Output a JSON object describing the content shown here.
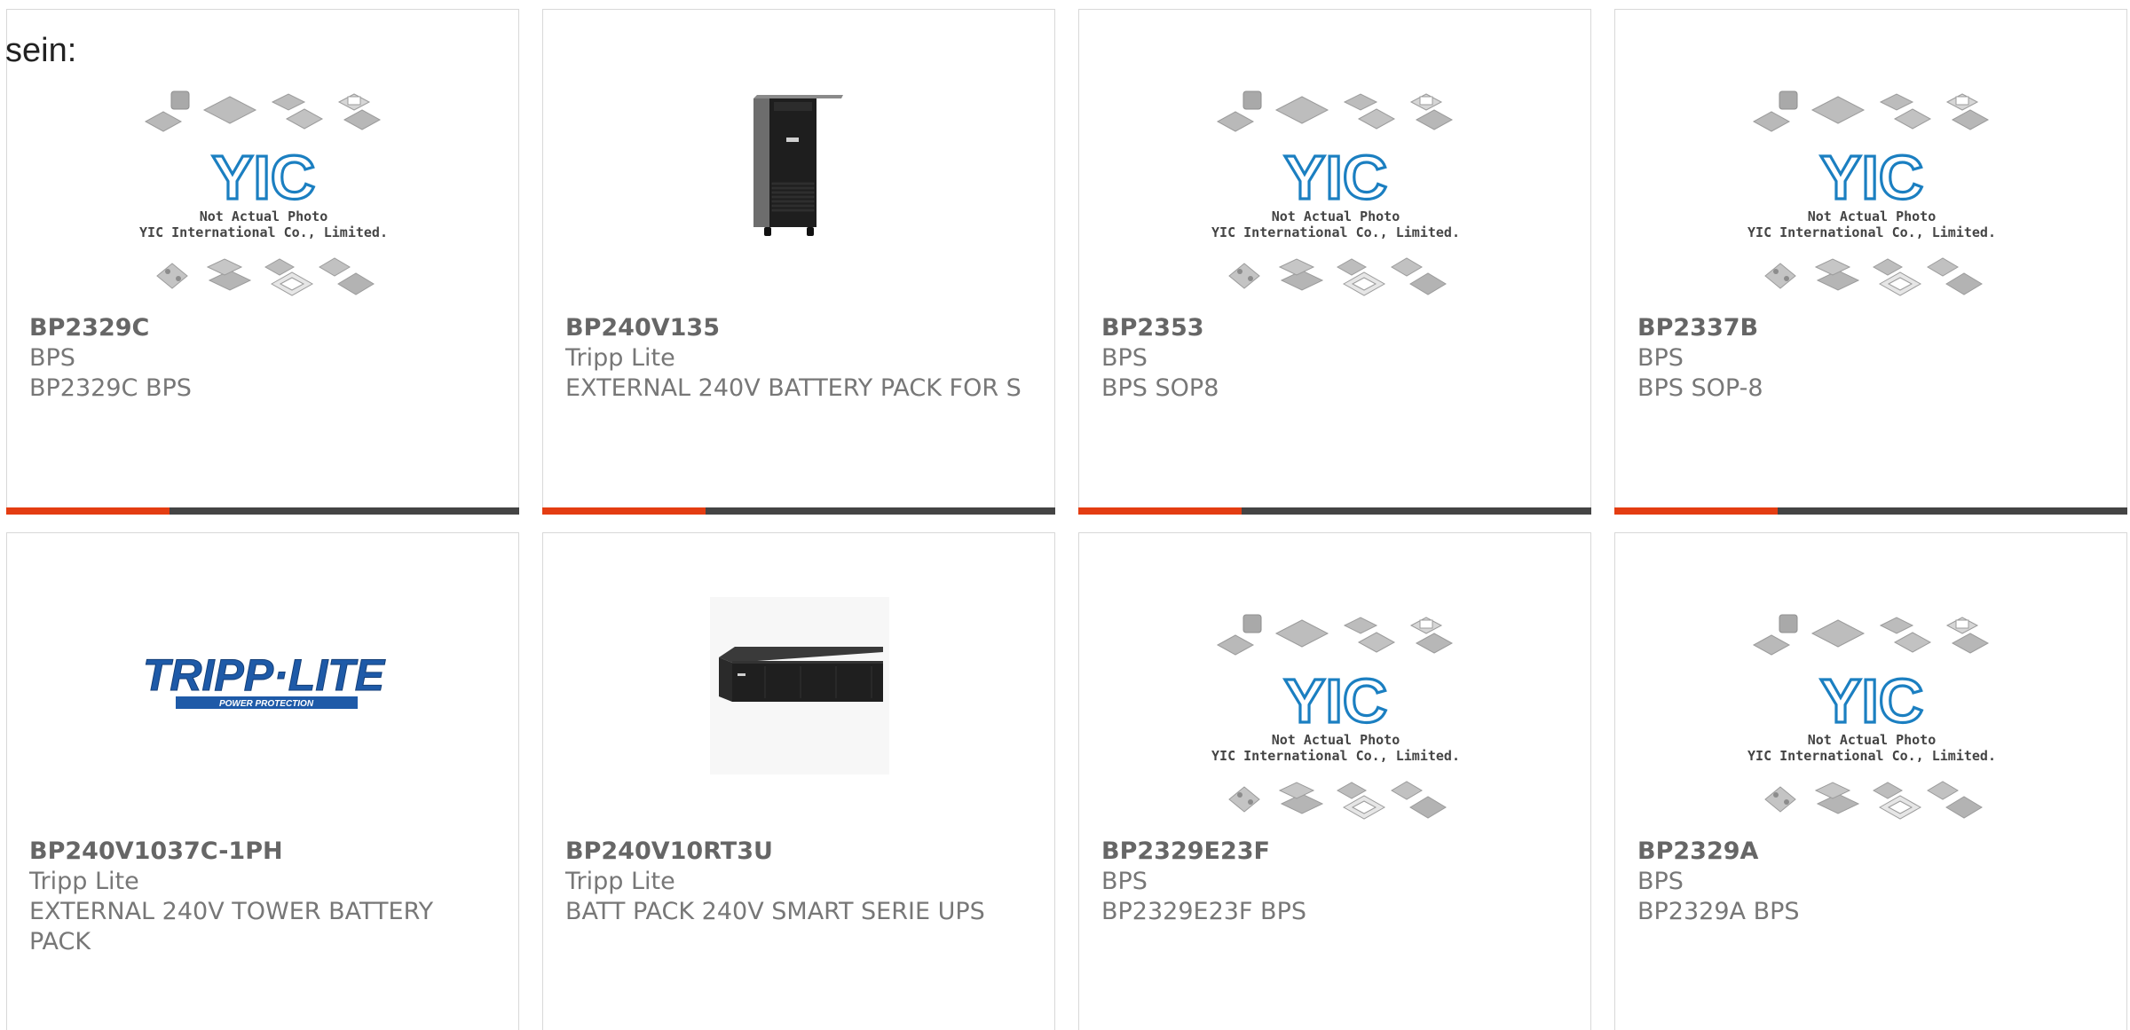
{
  "intro_text": "sein:",
  "placeholder_image": {
    "caption_line1": "Not Actual Photo",
    "caption_line2": "YIC International Co., Limited.",
    "logo_text": "YIC"
  },
  "tripplite_logo": {
    "main_text": "TRIPP·LITE",
    "sub_text": "POWER PROTECTION"
  },
  "colors": {
    "accent_bar": "#e43d12",
    "bar_dark": "#444444",
    "yic_blue": "#1b7fc1",
    "tripplite_blue": "#1e5aa8"
  },
  "products": [
    {
      "part_number": "BP2329C",
      "manufacturer": "BPS",
      "description": "BP2329C BPS",
      "image": "yic-placeholder-icon"
    },
    {
      "part_number": "BP240V135",
      "manufacturer": "Tripp Lite",
      "description": "EXTERNAL 240V BATTERY PACK FOR S",
      "image": "tower-battery-icon"
    },
    {
      "part_number": "BP2353",
      "manufacturer": "BPS",
      "description": "BPS SOP8",
      "image": "yic-placeholder-icon"
    },
    {
      "part_number": "BP2337B",
      "manufacturer": "BPS",
      "description": "BPS SOP-8",
      "image": "yic-placeholder-icon"
    },
    {
      "part_number": "BP240V1037C-1PH",
      "manufacturer": "Tripp Lite",
      "description": "EXTERNAL 240V TOWER BATTERY PACK",
      "image": "tripplite-logo-icon"
    },
    {
      "part_number": "BP240V10RT3U",
      "manufacturer": "Tripp Lite",
      "description": "BATT PACK 240V SMART SERIE UPS",
      "image": "rack-battery-icon"
    },
    {
      "part_number": "BP2329E23F",
      "manufacturer": "BPS",
      "description": "BP2329E23F BPS",
      "image": "yic-placeholder-icon"
    },
    {
      "part_number": "BP2329A",
      "manufacturer": "BPS",
      "description": "BP2329A BPS",
      "image": "yic-placeholder-icon"
    }
  ]
}
